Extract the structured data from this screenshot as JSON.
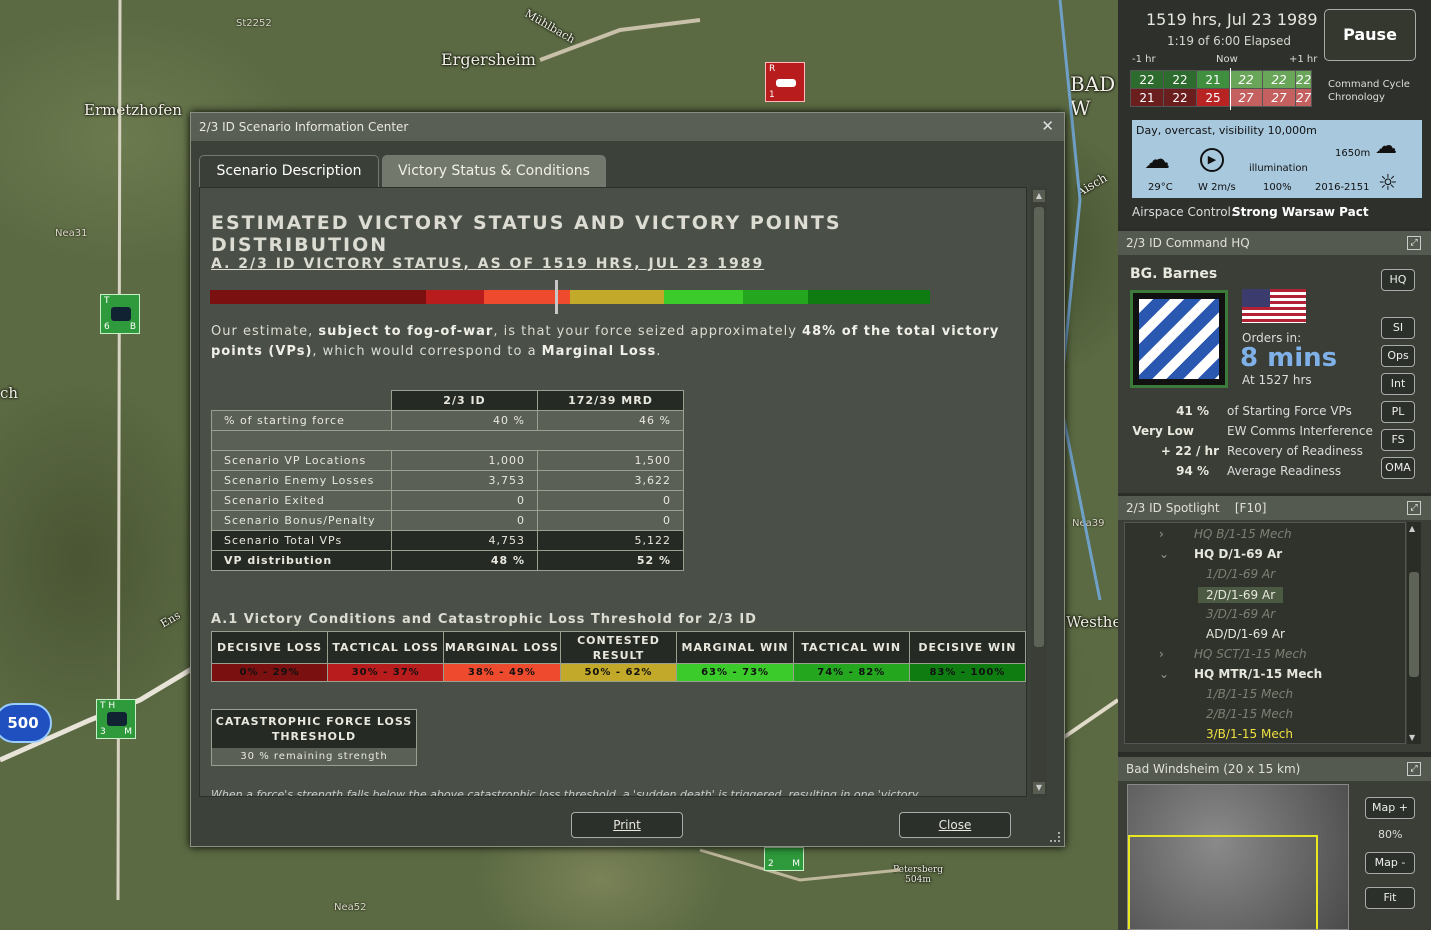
{
  "map": {
    "labels": [
      "Ergersheim",
      "Ermetzhofen",
      "Mühlbach",
      "BAD W",
      "Westhei",
      "Aisch",
      "ch",
      "Ens",
      "Petersberg 504m"
    ],
    "roads": [
      "St2252",
      "Nea31",
      "Nea39",
      "Nea52"
    ],
    "vp_marker": "500",
    "units": [
      {
        "top": "T",
        "bl": "6",
        "br": "B"
      },
      {
        "top": "T H",
        "bl": "3",
        "br": "M"
      },
      {
        "top": "R",
        "bl": "1",
        "br": ""
      },
      {
        "top": "",
        "bl": "2",
        "br": "M"
      }
    ]
  },
  "dialog": {
    "title": "2/3 ID Scenario Information Center",
    "close_glyph": "✕",
    "tabs": [
      "Scenario Description",
      "Victory Status & Conditions"
    ],
    "heading": "ESTIMATED VICTORY STATUS AND VICTORY POINTS DISTRIBUTION",
    "subheading": "A. 2/3 ID VICTORY STATUS, AS OF 1519 HRS, JUL 23 1989",
    "estimate_a": "Our estimate, ",
    "estimate_b": "subject to fog-of-war",
    "estimate_c": ", is that your force seized approximately ",
    "estimate_d": "48% of the total victory points (VPs)",
    "estimate_e": ", which would correspond to a ",
    "estimate_f": "Marginal Loss",
    "estimate_g": ".",
    "vp_table": {
      "headers": [
        "",
        "2/3 ID",
        "172/39 MRD"
      ],
      "rows": [
        [
          "% of starting force",
          "40 %",
          "46 %"
        ],
        [
          "Scenario VP Locations",
          "1,000",
          "1,500"
        ],
        [
          "Scenario Enemy Losses",
          "3,753",
          "3,622"
        ],
        [
          "Scenario Exited",
          "0",
          "0"
        ],
        [
          "Scenario Bonus/Penalty",
          "0",
          "0"
        ],
        [
          "Scenario Total VPs",
          "4,753",
          "5,122"
        ],
        [
          "VP distribution",
          "48 %",
          "52 %"
        ]
      ]
    },
    "conditions_title": "A.1 Victory Conditions and Catastrophic Loss Threshold for 2/3 ID",
    "conditions": [
      {
        "label": "DECISIVE LOSS",
        "range": "0% - 29%",
        "color": "#7a1010"
      },
      {
        "label": "TACTICAL LOSS",
        "range": "30% - 37%",
        "color": "#b81c1c"
      },
      {
        "label": "MARGINAL LOSS",
        "range": "38% - 49%",
        "color": "#ee4a2e"
      },
      {
        "label": "CONTESTED RESULT",
        "range": "50% - 62%",
        "color": "#c2a92a"
      },
      {
        "label": "MARGINAL WIN",
        "range": "63% - 73%",
        "color": "#3bcb2b"
      },
      {
        "label": "TACTICAL WIN",
        "range": "74% - 82%",
        "color": "#24a61e"
      },
      {
        "label": "DECISIVE WIN",
        "range": "83% - 100%",
        "color": "#0e7c10"
      }
    ],
    "vp_share": 0.48,
    "catastrophic_title": "CATASTROPHIC FORCE LOSS THRESHOLD",
    "catastrophic_value": "30 % remaining strength",
    "cut_text": "When a force's strength falls below the above catastrophic loss threshold, a 'sudden death' is triggered, resulting in one 'victory",
    "print_label": "Print",
    "close_label": "Close"
  },
  "clock": {
    "time": "1519 hrs, Jul 23 1989",
    "elapsed": "1:19 of 6:00 Elapsed",
    "pause_label": "Pause",
    "axis": [
      "-1 hr",
      "Now",
      "+1 hr"
    ],
    "blue_row": [
      "22",
      "22",
      "21",
      "22",
      "22",
      "22"
    ],
    "red_row": [
      "21",
      "22",
      "25",
      "27",
      "27",
      "27"
    ],
    "chron_label": "Command Cycle Chronology"
  },
  "weather": {
    "summary": "Day, overcast, visibility 10,000m",
    "temp": "29°C",
    "wind": "W 2m/s",
    "illumination_label": "illumination",
    "illumination": "100%",
    "cloud_base": "1650m",
    "daylight": "2016-2151",
    "airspace_label": "Airspace Control:",
    "airspace_value": "Strong Warsaw Pact"
  },
  "hq": {
    "title": "2/3 ID Command HQ",
    "commander": "BG. Barnes",
    "orders_label": "Orders in:",
    "orders_value": "8 mins",
    "orders_at": "At 1527 hrs",
    "buttons": [
      "HQ",
      "SI",
      "Ops",
      "Int",
      "PL",
      "FS",
      "OMA"
    ],
    "stats": [
      {
        "v": "41 %",
        "l": "of Starting Force VPs"
      },
      {
        "v": "Very Low",
        "l": "EW Comms Interference"
      },
      {
        "v": "+ 22 / hr",
        "l": "Recovery of Readiness"
      },
      {
        "v": "94 %",
        "l": "Average Readiness"
      }
    ]
  },
  "spotlight": {
    "title": "2/3 ID Spotlight    [F10]",
    "items": [
      {
        "t": "HQ B/1-15 Mech",
        "s": "i",
        "x": 75,
        "arrow": "›"
      },
      {
        "t": "HQ D/1-69 Ar",
        "s": "b",
        "x": 75,
        "arrow": "⌄"
      },
      {
        "t": "1/D/1-69 Ar",
        "s": "i",
        "x": 87,
        "arrow": ""
      },
      {
        "t": "2/D/1-69 Ar",
        "s": "n",
        "x": 87,
        "arrow": ""
      },
      {
        "t": "3/D/1-69 Ar",
        "s": "i",
        "x": 87,
        "arrow": ""
      },
      {
        "t": "AD/D/1-69 Ar",
        "s": "n",
        "x": 87,
        "arrow": ""
      },
      {
        "t": "HQ SCT/1-15 Mech",
        "s": "i",
        "x": 75,
        "arrow": "›"
      },
      {
        "t": "HQ MTR/1-15 Mech",
        "s": "b",
        "x": 75,
        "arrow": "⌄"
      },
      {
        "t": "1/B/1-15 Mech",
        "s": "i",
        "x": 87,
        "arrow": ""
      },
      {
        "t": "2/B/1-15 Mech",
        "s": "i",
        "x": 87,
        "arrow": ""
      },
      {
        "t": "3/B/1-15 Mech",
        "s": "y",
        "x": 87,
        "arrow": ""
      }
    ]
  },
  "minimap": {
    "title": "Bad Windsheim (20 x 15 km)",
    "zoom": "80%",
    "buttons": [
      "Map +",
      "Map -",
      "Fit"
    ]
  }
}
